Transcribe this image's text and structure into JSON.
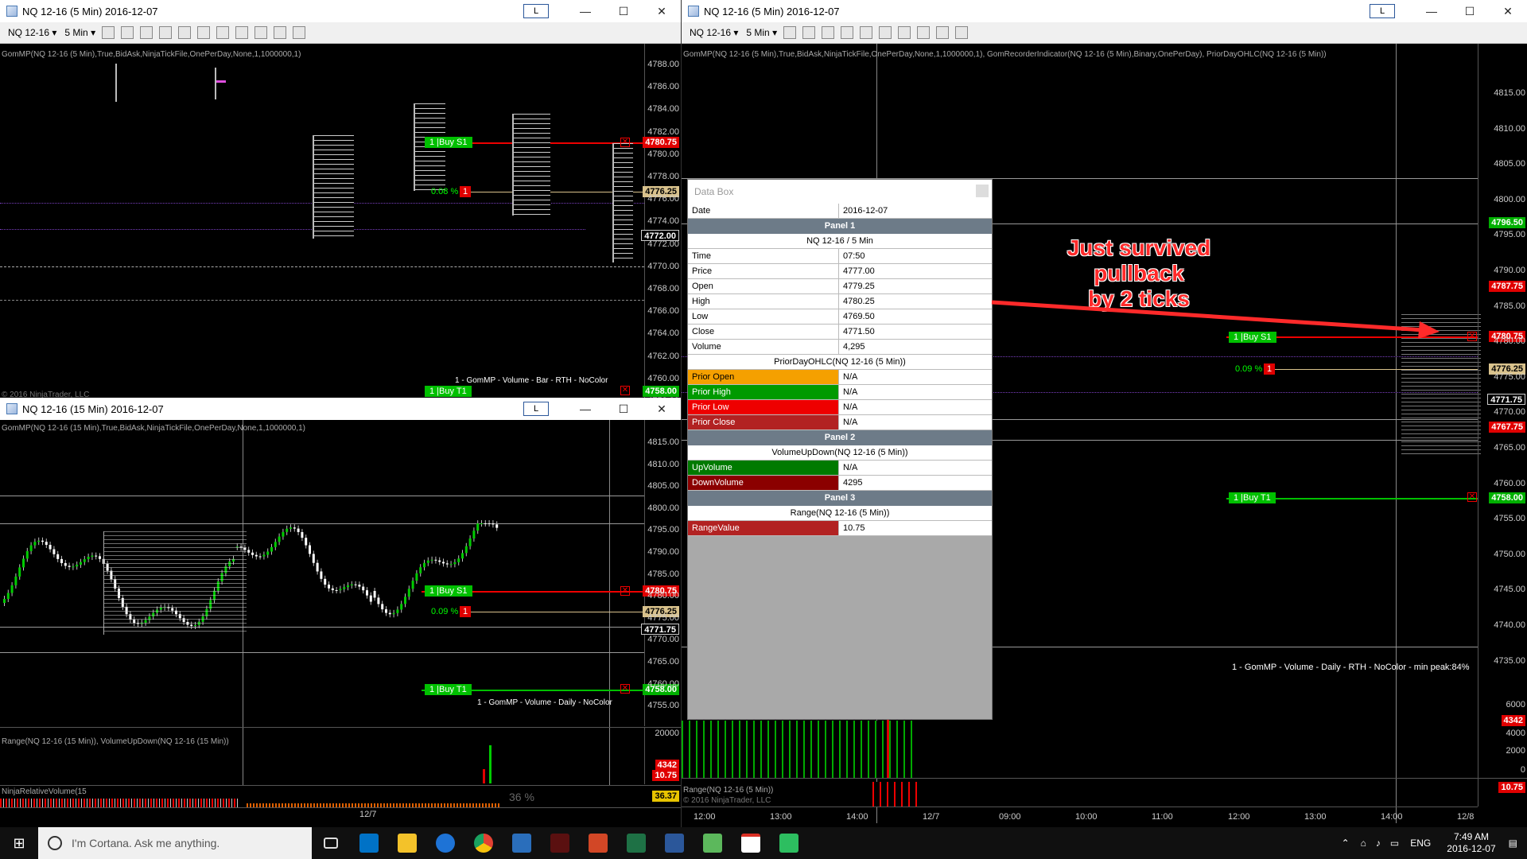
{
  "win_tl": {
    "title": "NQ 12-16 (5 Min)  2016-12-07",
    "toolbar": {
      "instrument": "NQ 12-16",
      "interval": "5 Min"
    },
    "indicator": "GomMP(NQ 12-16 (5 Min),True,BidAsk,NinjaTickFile,OnePerDay,None,1,1000000,1)",
    "ticks": [
      "4788.00",
      "4786.00",
      "4784.00",
      "4782.00",
      "4780.00",
      "4778.00",
      "4776.00",
      "4774.00",
      "4772.00",
      "4770.00",
      "4768.00",
      "4766.00",
      "4764.00",
      "4762.00",
      "4760.00",
      "4758.00"
    ],
    "labels": {
      "p1": "4780.75",
      "p2": "4776.25",
      "p3": "4772.00",
      "p4": "4758.00"
    },
    "buy_s1": "1 |Buy S1",
    "buy_t1": "1 |Buy T1",
    "pct": "0.08 %",
    "one": "1",
    "footer": "1 - GomMP - Volume - Bar - RTH - NoColor",
    "copyright": "© 2016 NinjaTrader, LLC"
  },
  "win_bl": {
    "title": "NQ 12-16 (15 Min)  2016-12-07",
    "indicator": "GomMP(NQ 12-16 (15 Min),True,BidAsk,NinjaTickFile,OnePerDay,None,1,1000000,1)",
    "ticks": [
      "4815.00",
      "4810.00",
      "4805.00",
      "4800.00",
      "4795.00",
      "4790.00",
      "4785.00",
      "4780.00",
      "4775.00",
      "4770.00",
      "4765.00",
      "4760.00",
      "4755.00"
    ],
    "labels": {
      "p1": "4780.75",
      "p2": "4776.25",
      "p3": "4771.75",
      "p4": "4758.00",
      "v1": "4342",
      "v2": "10.75",
      "v3": "36.37"
    },
    "buy_s1": "1 |Buy S1",
    "buy_t1": "1 |Buy T1",
    "pct": "0.09 %",
    "one": "1",
    "footer": "1 - GomMP - Volume - Daily - NoColor",
    "sub_indicator": "Range(NQ 12-16 (15 Min)), VolumeUpDown(NQ 12-16 (15 Min))",
    "sub_tick": "20000",
    "rel_indicator": "NinjaRelativeVolume(15",
    "rel_pct": "36 %",
    "date_label": "12/7"
  },
  "win_r": {
    "title": "NQ 12-16 (5 Min)  2016-12-07",
    "toolbar": {
      "instrument": "NQ 12-16",
      "interval": "5 Min"
    },
    "indicator": "GomMP(NQ 12-16 (5 Min),True,BidAsk,NinjaTickFile,OnePerDay,None,1,1000000,1), GomRecorderIndicator(NQ 12-16 (5 Min),Binary,OnePerDay), PriorDayOHLC(NQ 12-16 (5 Min))",
    "ticks": [
      "4815.00",
      "4810.00",
      "4805.00",
      "4800.00",
      "4795.00",
      "4790.00",
      "4785.00",
      "4780.00",
      "4775.00",
      "4770.00",
      "4765.00",
      "4760.00",
      "4755.00",
      "4750.00",
      "4745.00",
      "4740.00",
      "4735.00"
    ],
    "labels": {
      "p0": "4796.50",
      "p1": "4787.75",
      "p2": "4780.75",
      "p3": "4776.25",
      "p4": "4771.75",
      "p5": "4767.75",
      "p6": "4758.00",
      "v1": "4342",
      "v2": "10.75"
    },
    "buy_s1": "1 |Buy S1",
    "buy_t1": "1 |Buy T1",
    "pct": "0.09 %",
    "one": "1",
    "footer": "1 - GomMP - Volume - Daily - RTH - NoColor - min peak:84%",
    "vol_ticks": [
      "6000",
      "4000",
      "2000",
      "0"
    ],
    "range_indicator": "Range(NQ 12-16 (5 Min))",
    "copyright": "© 2016 NinjaTrader, LLC",
    "time_ticks": [
      "12:00",
      "13:00",
      "14:00",
      "12/7",
      "09:00",
      "10:00",
      "11:00",
      "12:00",
      "13:00",
      "14:00",
      "12/8"
    ]
  },
  "databox": {
    "title": "Data Box",
    "date_key": "Date",
    "date_val": "2016-12-07",
    "panel1": "Panel 1",
    "panel1_sub": "NQ 12-16 / 5 Min",
    "rows1": [
      {
        "k": "Time",
        "v": "07:50"
      },
      {
        "k": "Price",
        "v": "4777.00"
      },
      {
        "k": "Open",
        "v": "4779.25"
      },
      {
        "k": "High",
        "v": "4780.25"
      },
      {
        "k": "Low",
        "v": "4769.50"
      },
      {
        "k": "Close",
        "v": "4771.50"
      },
      {
        "k": "Volume",
        "v": "4,295"
      }
    ],
    "ohlc_sub": "PriorDayOHLC(NQ 12-16 (5 Min))",
    "ohlc": [
      {
        "k": "Prior Open",
        "v": "N/A",
        "c": "#f5a000"
      },
      {
        "k": "Prior High",
        "v": "N/A",
        "c": "#009a00"
      },
      {
        "k": "Prior Low",
        "v": "N/A",
        "c": "#ee0000"
      },
      {
        "k": "Prior Close",
        "v": "N/A",
        "c": "#b22222"
      }
    ],
    "panel2": "Panel 2",
    "panel2_sub": "VolumeUpDown(NQ 12-16 (5 Min))",
    "vol": [
      {
        "k": "UpVolume",
        "v": "N/A",
        "c": "#007a00"
      },
      {
        "k": "DownVolume",
        "v": "4295",
        "c": "#8b0000"
      }
    ],
    "panel3": "Panel 3",
    "panel3_sub": "Range(NQ 12-16 (5 Min))",
    "range": {
      "k": "RangeValue",
      "v": "10.75",
      "c": "#b22222"
    }
  },
  "annotation": {
    "line1": "Just survived pullback",
    "line2": "by 2 ticks"
  },
  "taskbar": {
    "search": "I'm Cortana. Ask me anything.",
    "lang": "ENG",
    "time": "7:49 AM",
    "date": "2016-12-07"
  },
  "colors": {
    "up": "#00cc00",
    "down": "#e00000",
    "buy": "#00c000",
    "accent": "#2b579a"
  }
}
